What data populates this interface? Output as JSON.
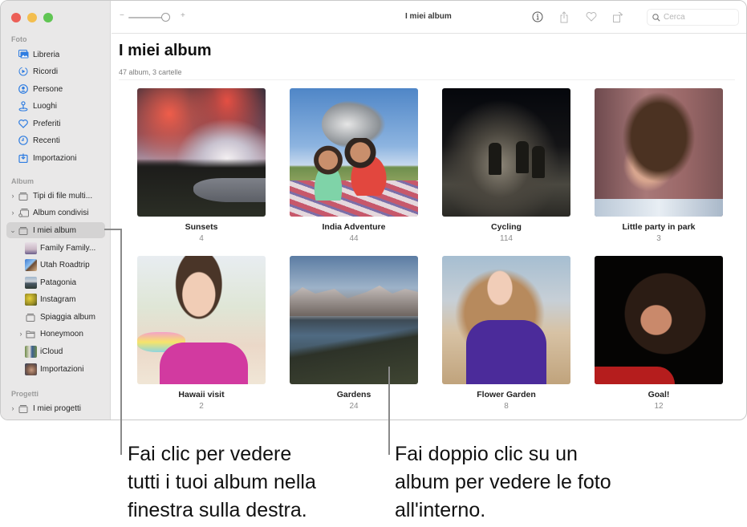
{
  "window": {
    "title": "I miei album",
    "traffic_lights": [
      "close",
      "minimize",
      "zoom"
    ]
  },
  "toolbar": {
    "zoom_minus": "−",
    "zoom_plus": "+",
    "zoom_level_fraction": 1.0,
    "search_placeholder": "Cerca",
    "icons": [
      "info-icon",
      "share-icon",
      "heart-icon",
      "rotate-icon"
    ]
  },
  "sidebar": {
    "sections": [
      {
        "label": "Foto",
        "items": [
          {
            "label": "Libreria",
            "icon": "library-icon"
          },
          {
            "label": "Ricordi",
            "icon": "memories-icon"
          },
          {
            "label": "Persone",
            "icon": "people-icon"
          },
          {
            "label": "Luoghi",
            "icon": "places-icon"
          },
          {
            "label": "Preferiti",
            "icon": "heart-icon"
          },
          {
            "label": "Recenti",
            "icon": "clock-icon"
          },
          {
            "label": "Importazioni",
            "icon": "import-icon"
          }
        ]
      },
      {
        "label": "Album",
        "items": [
          {
            "label": "Tipi di file multi...",
            "icon": "folder-icon",
            "chevron": "›"
          },
          {
            "label": "Album condivisi",
            "icon": "shared-album-icon",
            "chevron": "›"
          },
          {
            "label": "I miei album",
            "icon": "folder-icon",
            "chevron": "⌄",
            "selected": true
          },
          {
            "label": "Family Family...",
            "icon": "album-thumb"
          },
          {
            "label": "Utah Roadtrip",
            "icon": "album-thumb"
          },
          {
            "label": "Patagonia",
            "icon": "album-thumb"
          },
          {
            "label": "Instagram",
            "icon": "album-thumb"
          },
          {
            "label": "Spiaggia album",
            "icon": "album-icon"
          },
          {
            "label": "Honeymoon",
            "icon": "folder-icon",
            "chevron": "›"
          },
          {
            "label": "iCloud",
            "icon": "album-thumb"
          },
          {
            "label": "Importazioni",
            "icon": "album-thumb"
          }
        ]
      },
      {
        "label": "Progetti",
        "items": [
          {
            "label": "I miei progetti",
            "icon": "folder-icon",
            "chevron": "›"
          }
        ]
      }
    ]
  },
  "main": {
    "title": "I miei album",
    "subtitle": "47 album, 3 cartelle",
    "albums": [
      {
        "name": "Sunsets",
        "count": "4"
      },
      {
        "name": "India Adventure",
        "count": "44"
      },
      {
        "name": "Cycling",
        "count": "114"
      },
      {
        "name": "Little party in park",
        "count": "3"
      },
      {
        "name": "Hawaii visit",
        "count": "2"
      },
      {
        "name": "Gardens",
        "count": "24"
      },
      {
        "name": "Flower Garden",
        "count": "8"
      },
      {
        "name": "Goal!",
        "count": "12"
      }
    ]
  },
  "callouts": [
    {
      "lines": [
        "Fai clic per vedere",
        "tutti i tuoi album nella",
        "finestra sulla destra."
      ]
    },
    {
      "lines": [
        "Fai doppio clic su un",
        "album per vedere le foto",
        "all'interno."
      ]
    }
  ],
  "colors": {
    "accent": "#1f6fe0",
    "sidebar_bg": "#e9e8e8",
    "selected_bg": "#d4d3d3",
    "callout_line": "#8a8a8a"
  }
}
